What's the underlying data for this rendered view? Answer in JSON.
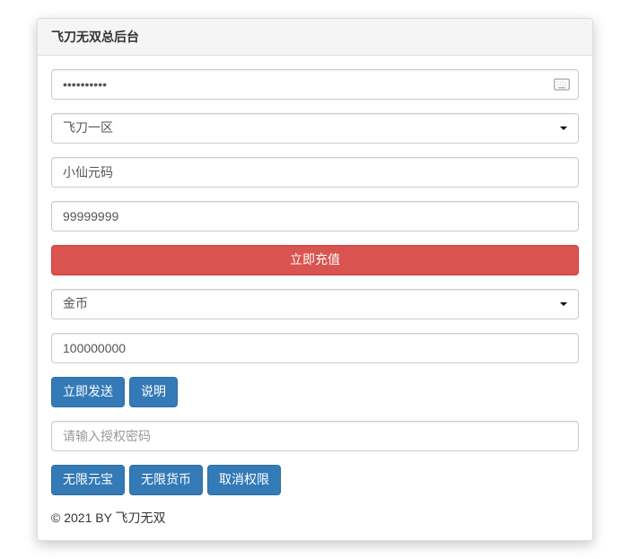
{
  "header": {
    "title": "飞刀无双总后台"
  },
  "form": {
    "password_value": "••••••••••",
    "server_selected": "飞刀一区",
    "player_name": "小仙元码",
    "recharge_amount": "99999999",
    "recharge_button": "立即充值",
    "currency_selected": "金币",
    "currency_amount": "100000000",
    "send_button": "立即发送",
    "explain_button": "说明",
    "auth_placeholder": "请输入授权密码",
    "unlimited_yuanbao": "无限元宝",
    "unlimited_currency": "无限货币",
    "cancel_permission": "取消权限"
  },
  "footer": {
    "text": "© 2021 BY 飞刀无双"
  }
}
